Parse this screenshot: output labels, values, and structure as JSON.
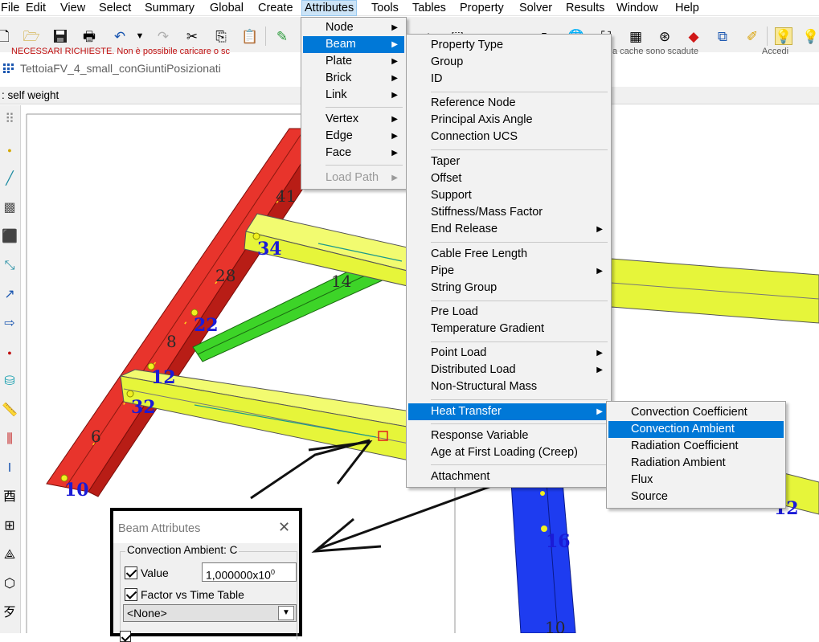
{
  "menubar": {
    "items": [
      "File",
      "Edit",
      "View",
      "Select",
      "Summary",
      "Global",
      "Create",
      "Attributes",
      "Tools",
      "Tables",
      "Property",
      "Solver",
      "Results",
      "Window",
      "Help"
    ],
    "active": "Attributes"
  },
  "toolbar": {
    "icons": [
      "new-file-icon",
      "open-folder-icon",
      "save-icon",
      "print-icon",
      "undo-icon",
      "undo-dropdown-icon",
      "redo-icon",
      "cut-icon",
      "copy-icon",
      "paste-icon",
      "edit-icon",
      "pin-icon",
      "model-icon",
      "select-icon",
      "globe-icon",
      "table-icon",
      "inspect-icon",
      "marker-icon",
      "structure-icon",
      "eraser-icon",
      "light-icon",
      "light-bulb-icon"
    ]
  },
  "status_line": {
    "left": "NECESSARI RICHIESTE. Non è possibile caricare o sc",
    "right": "a cache sono scadute"
  },
  "toolbar_right_label": "Accedi",
  "document": {
    "title": "TettoiaFV_4_small_conGiuntiPosizionati"
  },
  "load_case": {
    "label": ": self weight"
  },
  "attributes_menu": {
    "items": [
      {
        "label": "Node",
        "submenu": true
      },
      {
        "label": "Beam",
        "submenu": true,
        "highlighted": true
      },
      {
        "label": "Plate",
        "submenu": true
      },
      {
        "label": "Brick",
        "submenu": true
      },
      {
        "label": "Link",
        "submenu": true
      },
      {
        "label": "Vertex",
        "submenu": true
      },
      {
        "label": "Edge",
        "submenu": true
      },
      {
        "label": "Face",
        "submenu": true
      },
      {
        "label": "Load Path",
        "submenu": true,
        "disabled": true
      }
    ]
  },
  "beam_menu": {
    "items": [
      {
        "label": "Property Type"
      },
      {
        "label": "Group"
      },
      {
        "label": "ID"
      },
      {
        "label": "Reference Node"
      },
      {
        "label": "Principal Axis Angle"
      },
      {
        "label": "Connection UCS"
      },
      {
        "label": "Taper"
      },
      {
        "label": "Offset"
      },
      {
        "label": "Support"
      },
      {
        "label": "Stiffness/Mass Factor"
      },
      {
        "label": "End Release",
        "submenu": true
      },
      {
        "label": "Cable Free Length"
      },
      {
        "label": "Pipe",
        "submenu": true
      },
      {
        "label": "String Group"
      },
      {
        "label": "Pre Load"
      },
      {
        "label": "Temperature Gradient"
      },
      {
        "label": "Point Load",
        "submenu": true
      },
      {
        "label": "Distributed Load",
        "submenu": true
      },
      {
        "label": "Non-Structural Mass"
      },
      {
        "label": "Heat Transfer",
        "submenu": true,
        "highlighted": true
      },
      {
        "label": "Response Variable"
      },
      {
        "label": "Age at First Loading (Creep)"
      },
      {
        "label": "Attachment"
      }
    ]
  },
  "heat_transfer_menu": {
    "items": [
      {
        "label": "Convection Coefficient"
      },
      {
        "label": "Convection Ambient",
        "highlighted": true
      },
      {
        "label": "Radiation Coefficient"
      },
      {
        "label": "Radiation Ambient"
      },
      {
        "label": "Flux"
      },
      {
        "label": "Source"
      }
    ]
  },
  "dialog": {
    "title": "Beam Attributes",
    "close": "✕",
    "group_label": "Convection Ambient: C",
    "value_label": "Value",
    "value_checked": true,
    "value_mantissa": "1,000000x10",
    "value_exponent": "0",
    "factor_label": "Factor vs Time Table",
    "factor_checked": true,
    "table_selected": "<None>"
  },
  "scene": {
    "node_labels": [
      "34",
      "22",
      "12",
      "32",
      "10",
      "16",
      "12"
    ],
    "beam_labels": [
      "41",
      "28",
      "14",
      "8",
      "6",
      "10"
    ],
    "colors": {
      "red_beam": "#e8342c",
      "yellow_beam": "#e6f53a",
      "green_beam": "#3dd428",
      "blue_beam": "#1e3cf0",
      "node_label": "#1b1bd6",
      "beam_label": "#2a2a2a"
    }
  }
}
